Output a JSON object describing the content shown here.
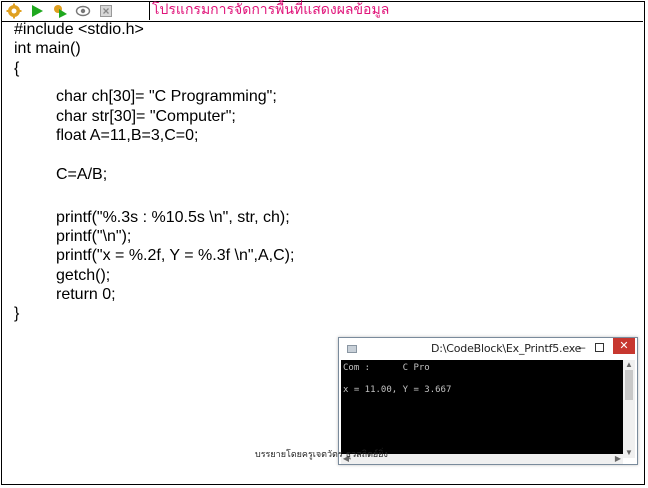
{
  "toolbar": {
    "icons": [
      "gear-icon",
      "play-icon",
      "build-run-icon",
      "debug-icon",
      "stop-icon"
    ],
    "title": "โปรแกรมการจัดการพื้นที่แสดงผลข้อมูล"
  },
  "code": {
    "lines": [
      "#include <stdio.h>",
      "int main()",
      "{",
      "char ch[30]= \"C Programming\";",
      "char str[30]= \"Computer\";",
      "float A=11,B=3,C=0;",
      "",
      "C=A/B;",
      "",
      "printf(\"%.3s : %10.5s \\n\", str, ch);",
      "printf(\"\\n\");",
      "printf(\"x = %.2f, Y = %.3f \\n\",A,C);",
      "getch();",
      "return 0;",
      "}"
    ]
  },
  "console": {
    "title": "D:\\CodeBlock\\Ex_Printf5.exe",
    "output": [
      "Com :      C Pro",
      "",
      "x = 11.00, Y = 3.667"
    ]
  },
  "caption": "บรรยายโดยครูเจตวัตร ธุวสถิตย์ยิ่ง"
}
